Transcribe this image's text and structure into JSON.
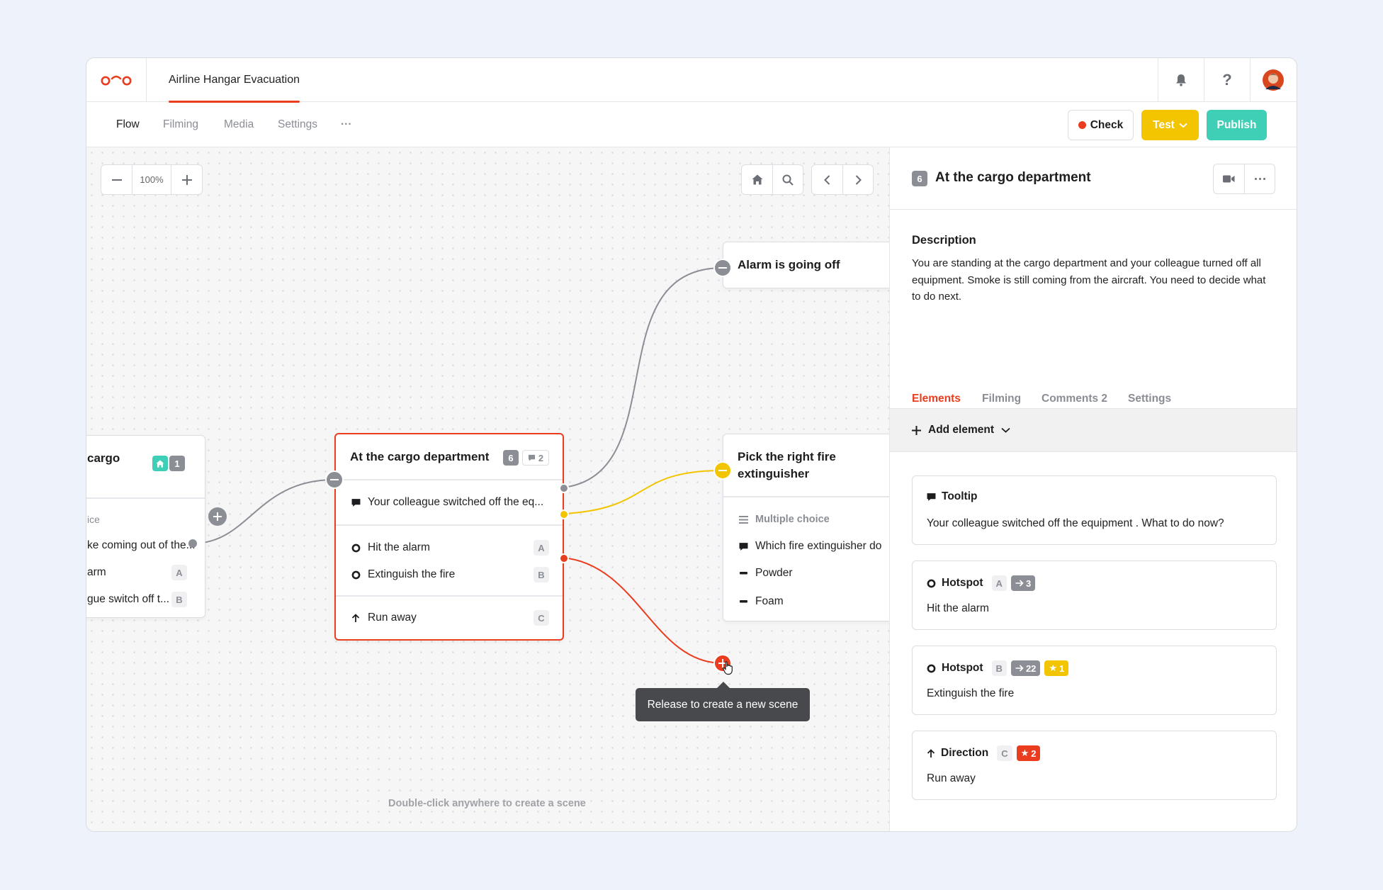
{
  "document": {
    "title": "Airline Hangar Evacuation"
  },
  "nav": {
    "tabs": [
      "Flow",
      "Filming",
      "Media",
      "Settings"
    ],
    "more": "···",
    "check_label": "Check",
    "test_label": "Test",
    "publish_label": "Publish"
  },
  "canvas": {
    "zoom": "100%",
    "hint": "Double-click anywhere to create a scene",
    "tooltip": "Release to create a new scene",
    "nodes": {
      "left": {
        "title": "cargo",
        "badge": "1",
        "rows": [
          "ice",
          "ke coming out of the...",
          "arm",
          "gue switch off t..."
        ],
        "keys": [
          "A",
          "B"
        ]
      },
      "center": {
        "title": "At the cargo department",
        "badge": "6",
        "comments": "2",
        "tooltip_row": "Your colleague switched off the eq...",
        "options": [
          {
            "label": "Hit the alarm",
            "key": "A"
          },
          {
            "label": "Extinguish the fire",
            "key": "B"
          },
          {
            "label": "Run away",
            "key": "C"
          }
        ]
      },
      "alarm": {
        "title": "Alarm is going off"
      },
      "fire": {
        "title": "Pick the right fire extinguisher",
        "rows": [
          "Multiple choice",
          "Which fire extinguisher do",
          "Powder",
          "Foam"
        ]
      }
    }
  },
  "panel": {
    "badge": "6",
    "title": "At the cargo department",
    "description_label": "Description",
    "description": "You are standing at the cargo department and your colleague turned off all equipment. Smoke is still coming from the aircraft. You need to decide what to do next.",
    "tabs": [
      "Elements",
      "Filming",
      "Comments 2",
      "Settings"
    ],
    "add_element": "Add element",
    "elements": [
      {
        "type": "Tooltip",
        "text": "Your colleague switched off the equipment . What to do now?"
      },
      {
        "type": "Hotspot",
        "key": "A",
        "link": "3",
        "text": "Hit the alarm"
      },
      {
        "type": "Hotspot",
        "key": "B",
        "link": "22",
        "score": "1",
        "text": "Extinguish the fire"
      },
      {
        "type": "Direction",
        "key": "C",
        "score": "2",
        "text": "Run away"
      }
    ]
  },
  "colors": {
    "accent": "#ea3d1f",
    "yellow": "#f3c500",
    "teal": "#3ecfb6",
    "gray": "#8b8e95"
  }
}
